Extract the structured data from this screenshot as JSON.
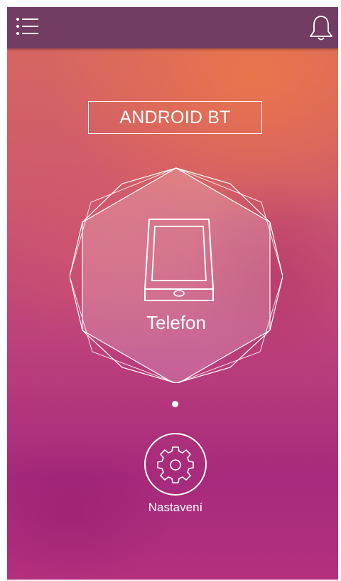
{
  "app": {
    "title": "ANDROID BT"
  },
  "topbar": {
    "menu_icon": "list-menu-icon",
    "notifications_icon": "bell-icon"
  },
  "main": {
    "device_label": "Telefon",
    "device_icon": "smartphone-icon",
    "page_indicator": {
      "pages": 1,
      "current": 1
    }
  },
  "footer": {
    "settings_label": "Nastavení",
    "settings_icon": "gear-icon"
  },
  "colors": {
    "topbar": "#733c63",
    "gradient_top": "#d9695f",
    "gradient_bottom": "#a72a7c",
    "foreground": "#ffffff"
  }
}
